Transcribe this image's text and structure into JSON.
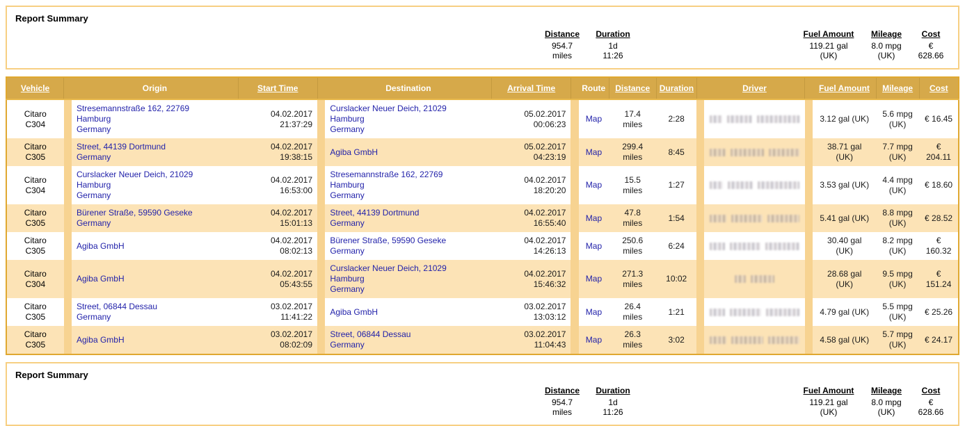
{
  "summary": {
    "title": "Report Summary",
    "columns": [
      {
        "key": "distance",
        "label": "Distance",
        "value": "954.7\nmiles"
      },
      {
        "key": "duration",
        "label": "Duration",
        "value": "1d\n11:26"
      },
      {
        "key": "fuel_amount",
        "label": "Fuel Amount",
        "value": "119.21 gal\n(UK)"
      },
      {
        "key": "mileage",
        "label": "Mileage",
        "value": "8.0 mpg\n(UK)"
      },
      {
        "key": "cost",
        "label": "Cost",
        "value": "€\n628.66"
      }
    ]
  },
  "table": {
    "headers": [
      {
        "key": "vehicle",
        "label": "Vehicle",
        "sortable": true
      },
      {
        "key": "origin",
        "label": "Origin",
        "sortable": false
      },
      {
        "key": "start_time",
        "label": "Start Time",
        "sortable": true
      },
      {
        "key": "destination",
        "label": "Destination",
        "sortable": false
      },
      {
        "key": "arrival_time",
        "label": "Arrival Time",
        "sortable": true
      },
      {
        "key": "route",
        "label": "Route",
        "sortable": false
      },
      {
        "key": "distance",
        "label": "Distance",
        "sortable": true
      },
      {
        "key": "duration",
        "label": "Duration",
        "sortable": true
      },
      {
        "key": "driver",
        "label": "Driver",
        "sortable": true
      },
      {
        "key": "fuel_amount",
        "label": "Fuel Amount",
        "sortable": true
      },
      {
        "key": "mileage",
        "label": "Mileage",
        "sortable": true
      },
      {
        "key": "cost",
        "label": "Cost",
        "sortable": true
      }
    ],
    "route_link_label": "Map",
    "rows": [
      {
        "vehicle": "Citaro\nC304",
        "origin": "Stresemannstraße 162, 22769\nHamburg\nGermany",
        "start_time": "04.02.2017\n21:37:29",
        "destination": "Curslacker Neuer Deich, 21029\nHamburg\nGermany",
        "arrival_time": "05.02.2017\n00:06:23",
        "route": "Map",
        "distance": "17.4 miles",
        "duration": "2:28",
        "driver": "",
        "fuel_amount": "3.12 gal (UK)",
        "mileage": "5.6 mpg\n(UK)",
        "cost": "€ 16.45"
      },
      {
        "vehicle": "Citaro\nC305",
        "origin": "Street, 44139 Dortmund\nGermany",
        "start_time": "04.02.2017\n19:38:15",
        "destination": "Agiba GmbH",
        "arrival_time": "05.02.2017\n04:23:19",
        "route": "Map",
        "distance": "299.4\nmiles",
        "duration": "8:45",
        "driver": "",
        "fuel_amount": "38.71 gal (UK)",
        "mileage": "7.7 mpg\n(UK)",
        "cost": "€\n204.11"
      },
      {
        "vehicle": "Citaro\nC304",
        "origin": "Curslacker Neuer Deich, 21029\nHamburg\nGermany",
        "start_time": "04.02.2017\n16:53:00",
        "destination": "Stresemannstraße 162, 22769\nHamburg\nGermany",
        "arrival_time": "04.02.2017\n18:20:20",
        "route": "Map",
        "distance": "15.5 miles",
        "duration": "1:27",
        "driver": "",
        "fuel_amount": "3.53 gal (UK)",
        "mileage": "4.4 mpg\n(UK)",
        "cost": "€ 18.60"
      },
      {
        "vehicle": "Citaro\nC305",
        "origin": "Bürener Straße, 59590 Geseke\nGermany",
        "start_time": "04.02.2017\n15:01:13",
        "destination": "Street, 44139 Dortmund\nGermany",
        "arrival_time": "04.02.2017\n16:55:40",
        "route": "Map",
        "distance": "47.8 miles",
        "duration": "1:54",
        "driver": "",
        "fuel_amount": "5.41 gal (UK)",
        "mileage": "8.8 mpg\n(UK)",
        "cost": "€ 28.52"
      },
      {
        "vehicle": "Citaro\nC305",
        "origin": "Agiba GmbH",
        "start_time": "04.02.2017\n08:02:13",
        "destination": "Bürener Straße, 59590 Geseke\nGermany",
        "arrival_time": "04.02.2017\n14:26:13",
        "route": "Map",
        "distance": "250.6\nmiles",
        "duration": "6:24",
        "driver": "",
        "fuel_amount": "30.40 gal (UK)",
        "mileage": "8.2 mpg\n(UK)",
        "cost": "€\n160.32"
      },
      {
        "vehicle": "Citaro\nC304",
        "origin": "Agiba GmbH",
        "start_time": "04.02.2017\n05:43:55",
        "destination": "Curslacker Neuer Deich, 21029\nHamburg\nGermany",
        "arrival_time": "04.02.2017\n15:46:32",
        "route": "Map",
        "distance": "271.3\nmiles",
        "duration": "10:02",
        "driver": "",
        "fuel_amount": "28.68 gal (UK)",
        "mileage": "9.5 mpg\n(UK)",
        "cost": "€\n151.24"
      },
      {
        "vehicle": "Citaro\nC305",
        "origin": "Street, 06844 Dessau\nGermany",
        "start_time": "03.02.2017\n11:41:22",
        "destination": "Agiba GmbH",
        "arrival_time": "03.02.2017\n13:03:12",
        "route": "Map",
        "distance": "26.4 miles",
        "duration": "1:21",
        "driver": "",
        "fuel_amount": "4.79 gal (UK)",
        "mileage": "5.5 mpg\n(UK)",
        "cost": "€ 25.26"
      },
      {
        "vehicle": "Citaro\nC305",
        "origin": "Agiba GmbH",
        "start_time": "03.02.2017\n08:02:09",
        "destination": "Street, 06844 Dessau\nGermany",
        "arrival_time": "03.02.2017\n11:04:43",
        "route": "Map",
        "distance": "26.3 miles",
        "duration": "3:02",
        "driver": "",
        "fuel_amount": "4.58 gal (UK)",
        "mileage": "5.7 mpg\n(UK)",
        "cost": "€ 24.17"
      }
    ]
  },
  "colors": {
    "header_gold": "#d6a94a",
    "panel_border": "#f7cf82",
    "table_border": "#e0a830",
    "row_even": "#fce3b6",
    "row_odd": "#ffffff",
    "spacer": "#f7d391",
    "link_blue": "#2222aa"
  }
}
